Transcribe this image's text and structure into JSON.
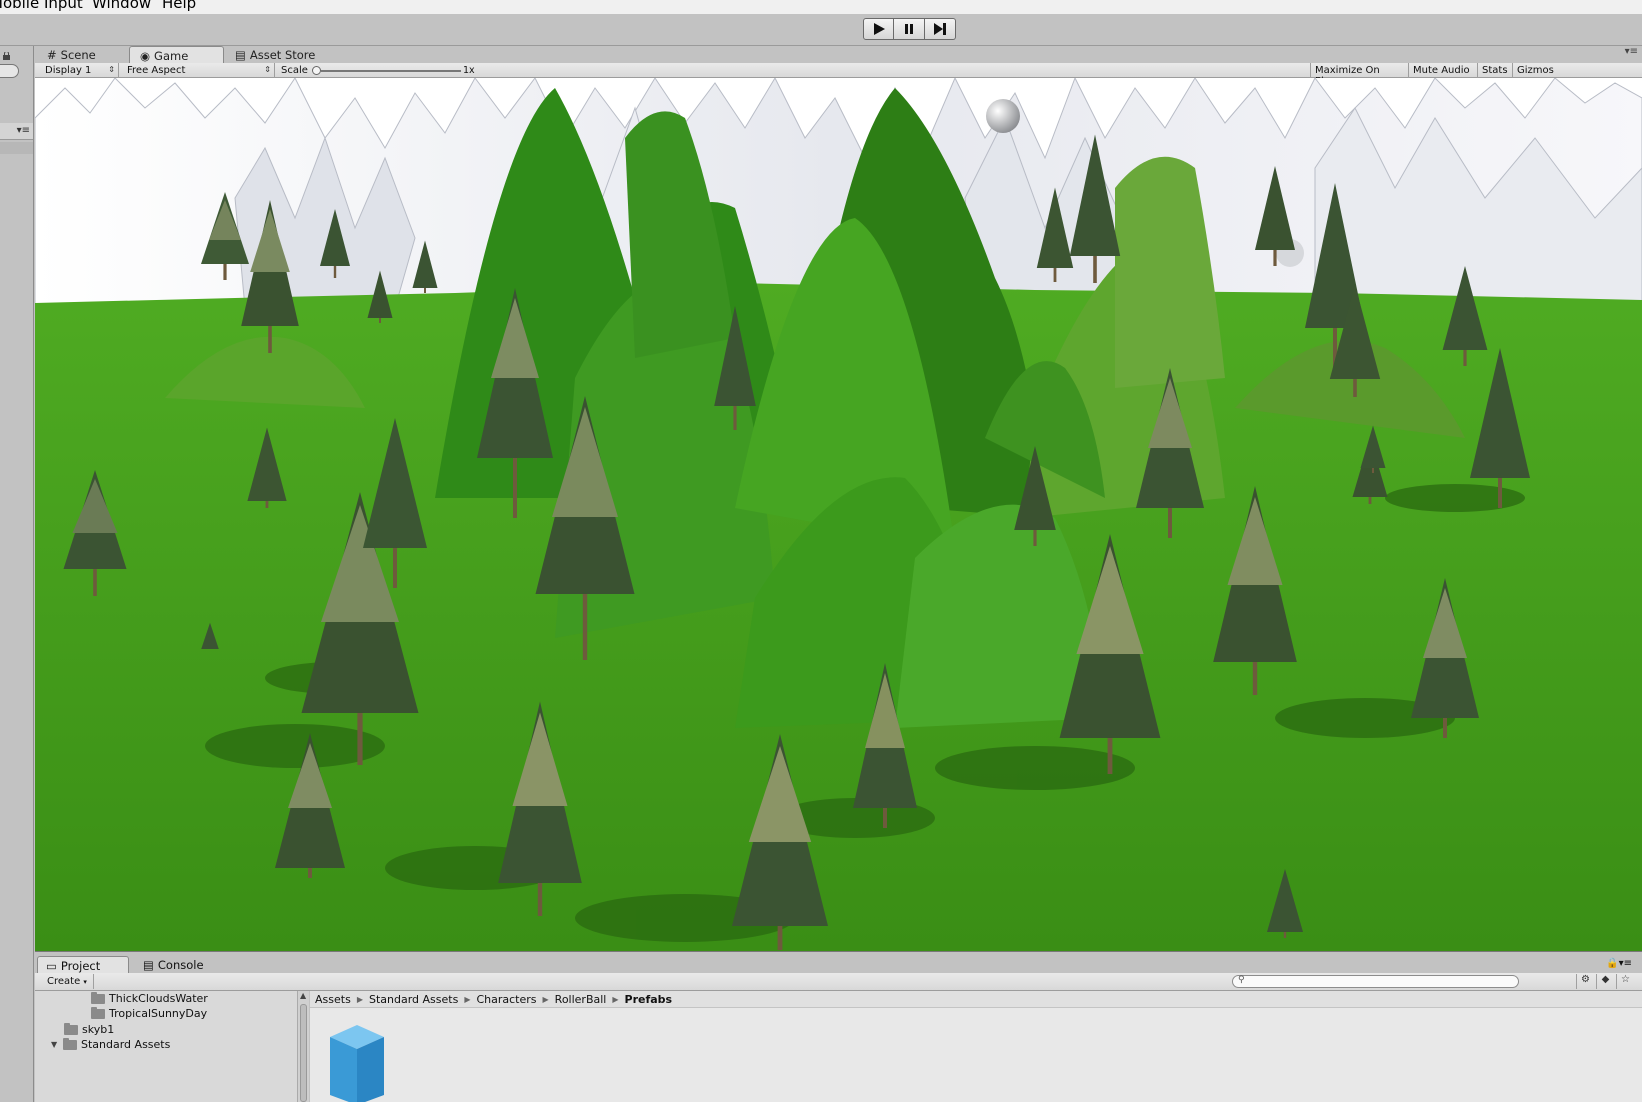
{
  "menubar": {
    "items": [
      "Mobile Input",
      "Window",
      "Help"
    ]
  },
  "toolbar": {
    "play": "play-icon",
    "pause": "pause-icon",
    "step": "step-icon"
  },
  "tabs": {
    "scene": "Scene",
    "game": "Game",
    "asset_store": "Asset Store"
  },
  "gamebar": {
    "display": "Display 1",
    "aspect": "Free Aspect",
    "scale_label": "Scale",
    "scale_value": "1x",
    "maximize": "Maximize On Play",
    "mute": "Mute Audio",
    "stats": "Stats",
    "gizmos": "Gizmos"
  },
  "project": {
    "tab_project": "Project",
    "tab_console": "Console",
    "create": "Create",
    "tree": [
      "ThickCloudsWater",
      "TropicalSunnyDay",
      "skyb1",
      "Standard Assets"
    ],
    "breadcrumb": [
      "Assets",
      "Standard Assets",
      "Characters",
      "RollerBall",
      "Prefabs"
    ]
  },
  "colors": {
    "grass": "#3f9a1a",
    "snow": "#f2f3f6",
    "editor_bg": "#c2c2c2"
  }
}
